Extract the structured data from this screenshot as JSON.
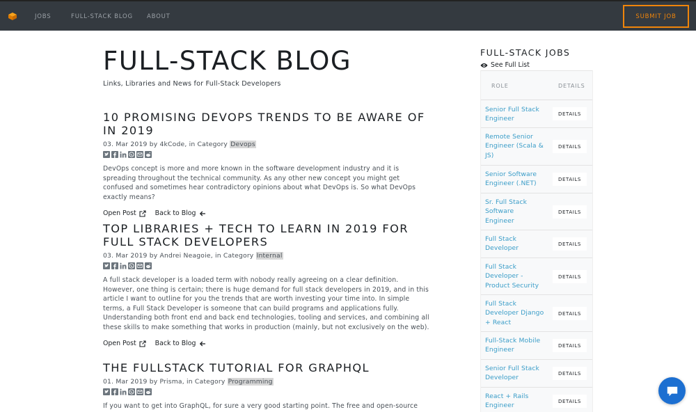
{
  "nav": {
    "links": [
      "JOBS",
      "FULL-STACK BLOG",
      "ABOUT"
    ],
    "submit_label": "SUBMIT JOB",
    "accent_color": "#f0850a"
  },
  "header": {
    "title": "FULL-STACK BLOG",
    "subtitle": "Links, Libraries and News for Full-Stack Developers"
  },
  "posts": [
    {
      "title": "10 PROMISING DEVOPS TRENDS TO BE AWARE OF IN 2019",
      "meta_prefix": "03. Mar 2019 by 4kCode, in Category ",
      "category": "Devops",
      "excerpt": "DevOps concept is more and more known in the software development industry and it is spreading throughout the technical community. As any other new concept you might get confused and sometimes hear contradictory opinions about what DevOps is. So what DevOps exactly means?",
      "open_label": "Open Post",
      "back_label": "Back to Blog"
    },
    {
      "title": "TOP LIBRARIES + TECH TO LEARN IN 2019 FOR FULL STACK DEVELOPERS",
      "meta_prefix": "03. Mar 2019 by Andrei Neagoie, in Category ",
      "category": "Internal",
      "excerpt": "A full stack developer is a loaded term with nobody really agreeing on a clear definition. However, one thing is certain; there is huge demand for full stack developers in 2019, and in this article I want to outline for you the trends that are worth investing your time into. In simple terms, a Full Stack Developer is someone that can build programs and applications fully. Understanding both front end and back end technologies, tooling and services, and combining all these skills to make something that works in production (mainly, but not exclusively on the web).",
      "open_label": "Open Post",
      "back_label": "Back to Blog"
    },
    {
      "title": "THE FULLSTACK TUTORIAL FOR GRAPHQL",
      "meta_prefix": "01. Mar 2019 by Prisma, in Category ",
      "category": "Programming",
      "excerpt": "If you want to get into GraphQL, for sure a very good starting point. The free and open-source"
    }
  ],
  "sidebar": {
    "title": "FULL-STACK JOBS",
    "see_full": "See Full List",
    "col_role": "ROLE",
    "col_details": "DETAILS",
    "details_label": "DETAILS",
    "jobs": [
      "Senior Full Stack Engineer",
      "Remote Senior Engineer (Scala & JS)",
      "Senior Software Engineer (.NET)",
      "Sr. Full Stack Software Engineer",
      "Full Stack Developer",
      "Full Stack Developer - Product Security",
      "Full Stack Developer Django + React",
      "Full-Stack Mobile Engineer",
      "Senior Full Stack Developer",
      "React + Rails Engineer"
    ]
  }
}
